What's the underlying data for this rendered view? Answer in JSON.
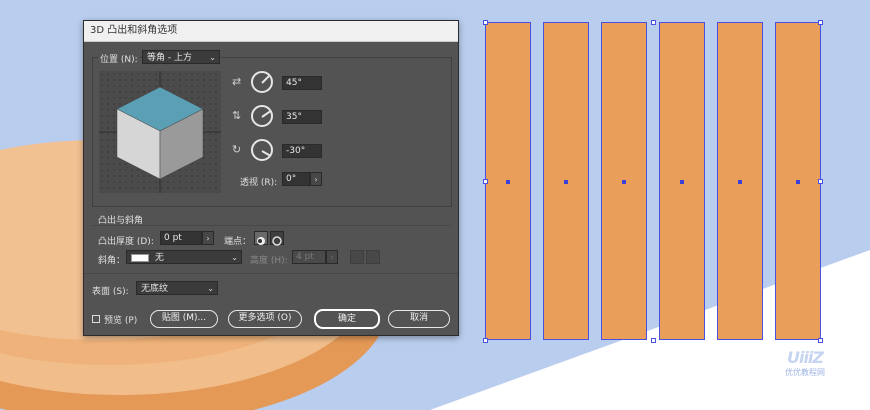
{
  "dialog": {
    "title": "3D 凸出和斜角选项",
    "position_label": "位置 (N):",
    "position_value": "等角 - 上方",
    "rot_x": "45°",
    "rot_y": "35°",
    "rot_z": "-30°",
    "perspective_label": "透视 (R):",
    "perspective_value": "0°",
    "extrude_section": "凸出与斜角",
    "extrude_depth_label": "凸出厚度 (D):",
    "extrude_depth_value": "0 pt",
    "cap_label": "端点：",
    "bevel_label": "斜角：",
    "bevel_value": "无",
    "height_label": "高度 (H):",
    "height_value": "4 pt",
    "surface_label": "表面 (S):",
    "surface_value": "无底纹",
    "preview_label": "预览 (P)",
    "map_button": "贴图 (M)...",
    "more_button": "更多选项 (O)",
    "ok_button": "确定",
    "cancel_button": "取消"
  },
  "watermark": {
    "logo": "UiiiZ",
    "text": "优优教程网"
  },
  "colors": {
    "background": "#b9cdee",
    "bar": "#e99e5a",
    "selection": "#4a50e0",
    "dialog": "#535353",
    "cube_top": "#5b9fb5"
  }
}
